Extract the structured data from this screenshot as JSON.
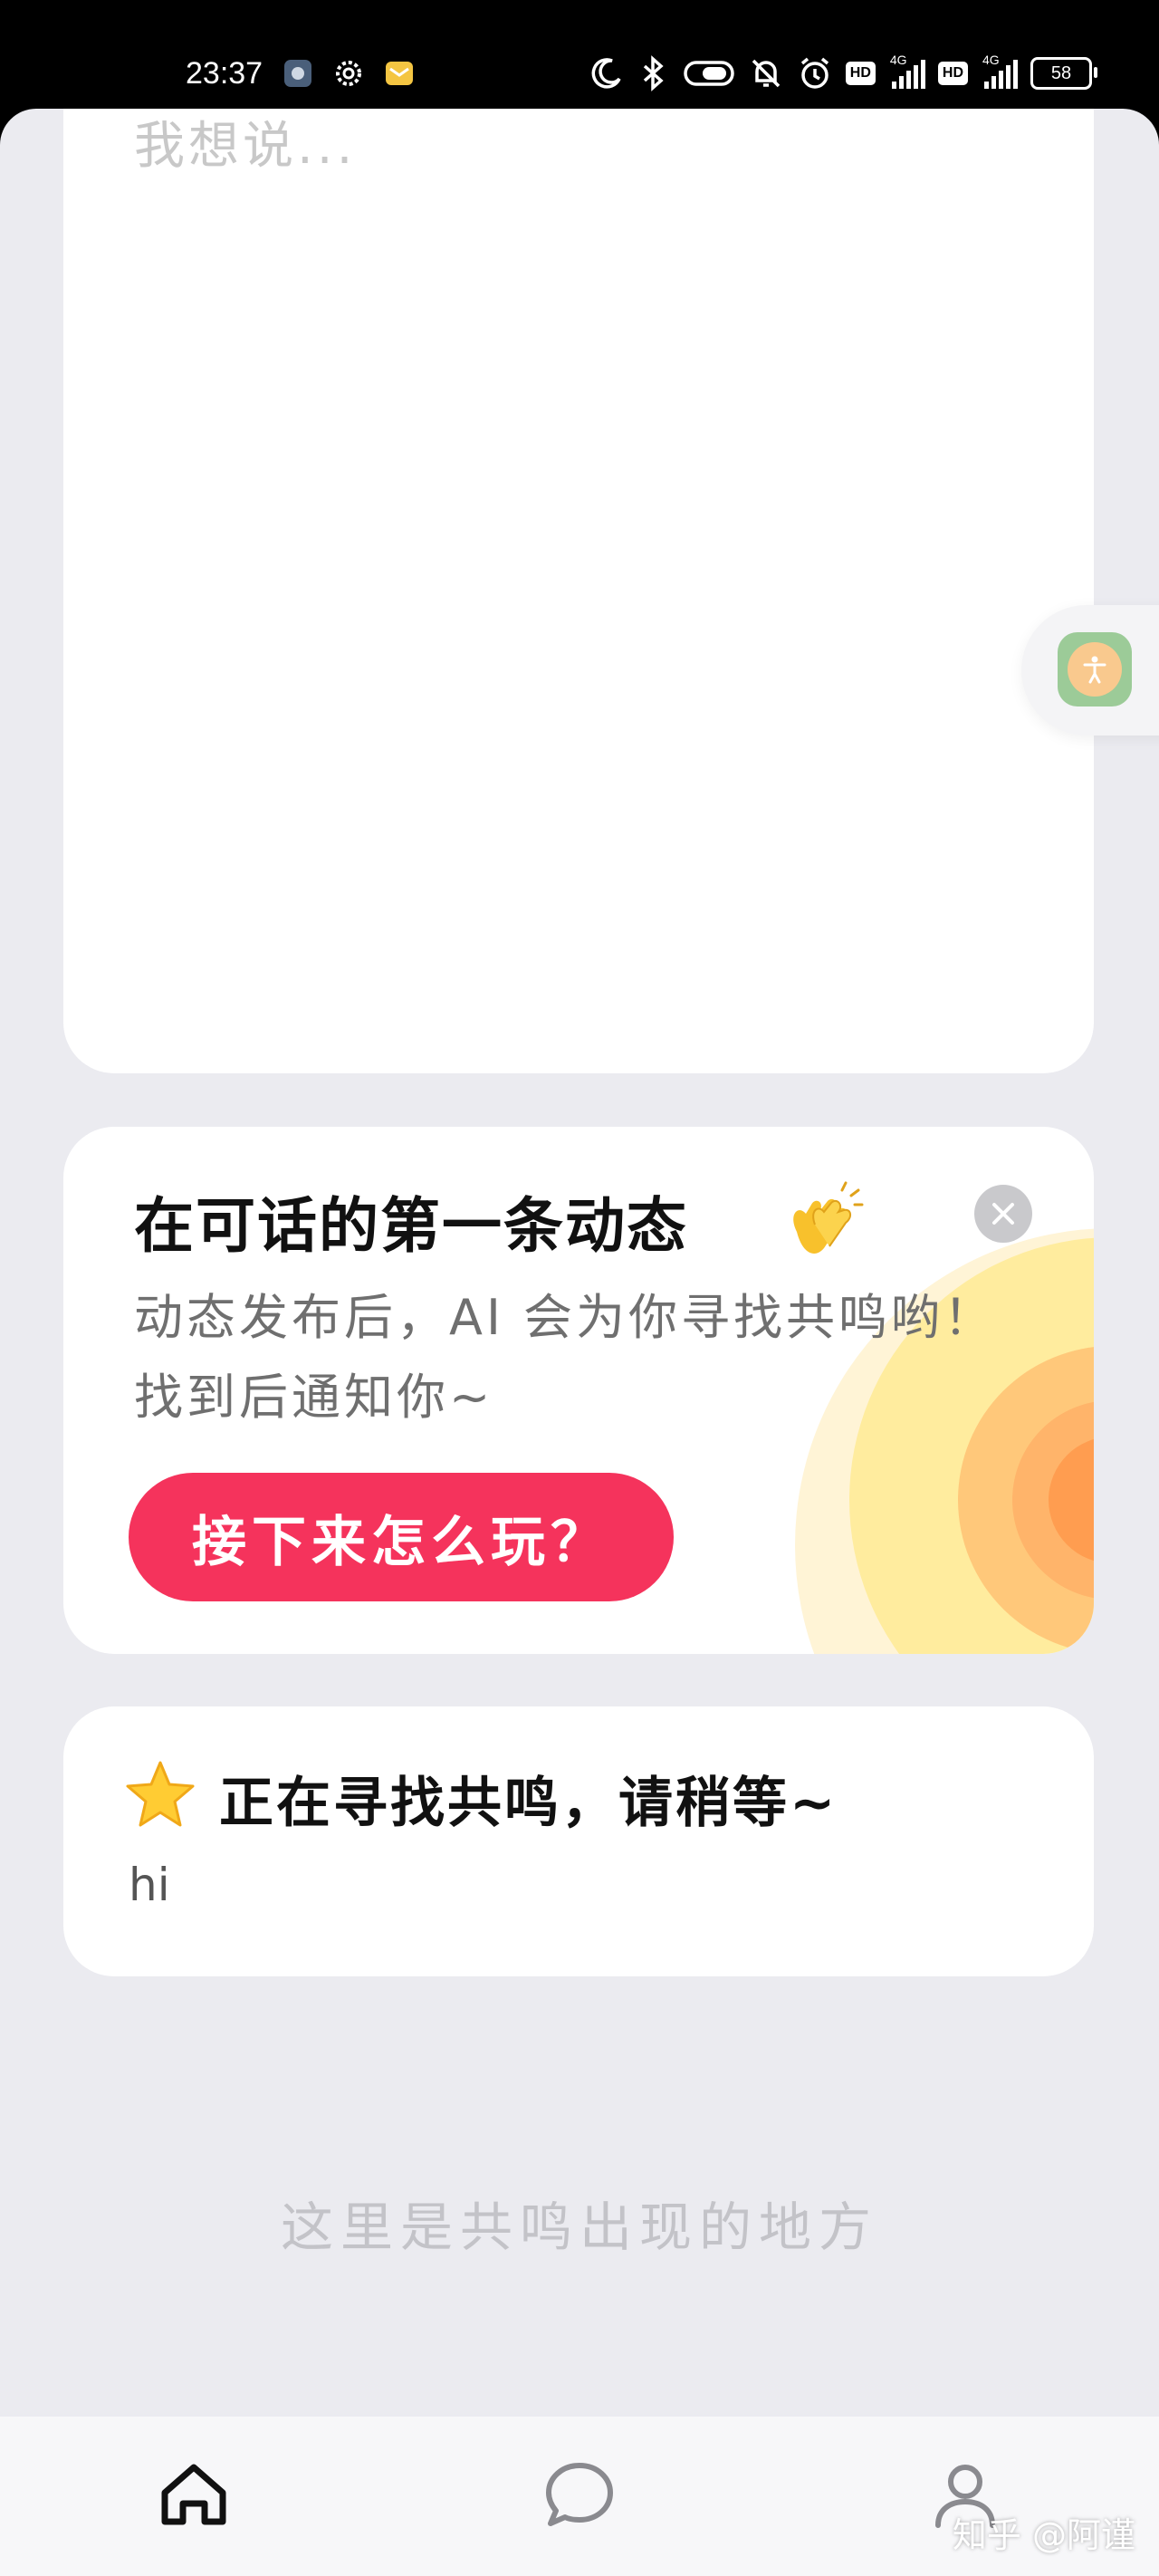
{
  "status_bar": {
    "time": "23:37",
    "network_type": "4G",
    "hd_label": "HD",
    "battery": "58",
    "icons": [
      "settings-icon",
      "gear-icon",
      "mail-icon",
      "moon-icon",
      "bluetooth-icon",
      "vibrate-icon",
      "mute-icon",
      "alarm-icon",
      "hd-icon",
      "signal-icon",
      "hd-icon",
      "signal-icon",
      "battery-icon"
    ]
  },
  "compose": {
    "placeholder": "我想说..."
  },
  "tip_card": {
    "title": "在可话的第一条动态",
    "emoji": "clapping-hands-icon",
    "description_line1": "动态发布后，AI 会为你寻找共鸣哟！",
    "description_line2": "找到后通知你~",
    "button_label": "接下来怎么玩？",
    "accent_color": "#f5335c"
  },
  "status_card": {
    "title": "正在寻找共鸣，请稍等~",
    "content": "hi"
  },
  "empty_hint": "这里是共鸣出现的地方",
  "bottom_nav": {
    "items": [
      {
        "icon": "home-icon",
        "active": true
      },
      {
        "icon": "chat-icon",
        "active": false
      },
      {
        "icon": "profile-icon",
        "active": false
      }
    ]
  },
  "watermark": "知乎 @阿谨"
}
